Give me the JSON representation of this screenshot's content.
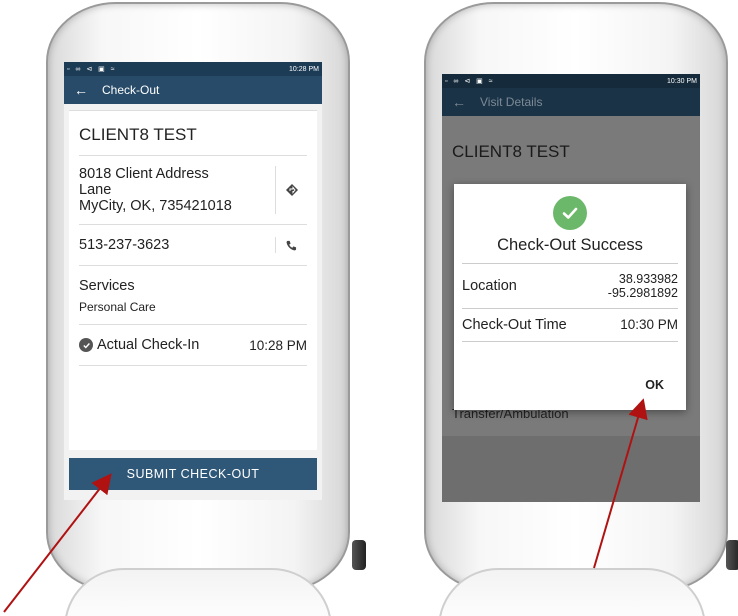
{
  "left_screen": {
    "status_time": "10:28 PM",
    "app_title": "Check-Out",
    "client_name": "CLIENT8 TEST",
    "address_line1": "8018 Client Address",
    "address_line2": "Lane",
    "address_line3": "MyCity, OK, 735421018",
    "phone": "513-237-3623",
    "services_title": "Services",
    "services_value": "Personal Care",
    "checkin_label": "Actual Check-In",
    "checkin_time": "10:28 PM",
    "submit_label": "SUBMIT CHECK-OUT",
    "icons": {
      "back": "back-arrow-icon",
      "directions": "directions-icon",
      "phone": "phone-icon",
      "check": "check-circle-icon"
    }
  },
  "right_screen": {
    "status_time": "10:30 PM",
    "app_title": "Visit Details",
    "client_name": "CLIENT8 TEST",
    "background_text": "Transfer/Ambulation",
    "dialog": {
      "title": "Check-Out Success",
      "location_label": "Location",
      "latitude": "38.933982",
      "longitude": "-95.2981892",
      "time_label": "Check-Out Time",
      "time_value": "10:30 PM",
      "ok_label": "OK"
    },
    "icons": {
      "success": "success-check-icon"
    }
  },
  "colors": {
    "status_bar": "#1c3b55",
    "app_bar": "#274b68",
    "button": "#2f5778",
    "success": "#6cb86a",
    "arrow": "#b01212"
  }
}
